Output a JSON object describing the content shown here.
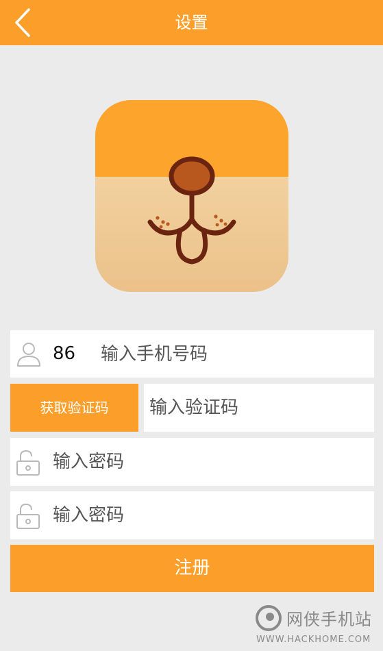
{
  "header": {
    "title": "设置",
    "back_icon": "chevron-left-icon"
  },
  "logo": {
    "description_icon": "dog-face-app-logo-icon",
    "colors": {
      "top": "#fca42b",
      "bottom_light": "#f4d7a6",
      "bottom_dark": "#ebc08a",
      "outline": "#6b2410",
      "nose": "#b5541d"
    }
  },
  "form": {
    "phone": {
      "country_code": "86",
      "placeholder": "输入手机号码",
      "icon": "user-icon"
    },
    "code": {
      "button_label": "获取验证码",
      "placeholder": "输入验证码"
    },
    "password": {
      "placeholder": "输入密码",
      "icon": "lock-icon"
    },
    "password_confirm": {
      "placeholder": "输入密码",
      "icon": "lock-icon"
    },
    "register_label": "注册"
  },
  "watermark": {
    "name": "网侠手机站",
    "url": "WWW.HACKHOME.COM"
  },
  "colors": {
    "accent": "#fb9f2a",
    "background": "#ebebeb"
  }
}
